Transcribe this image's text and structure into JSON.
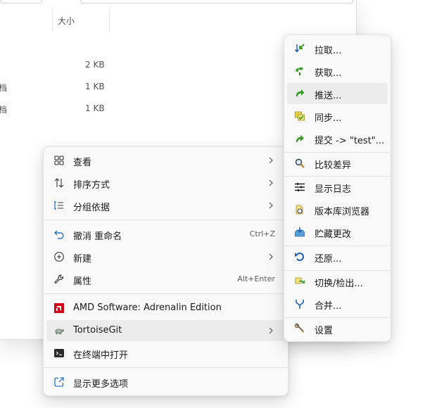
{
  "explorer": {
    "size_header": "大小",
    "files": [
      {
        "type": "",
        "size": "2 KB"
      },
      {
        "type": "档",
        "size": "1 KB"
      },
      {
        "type": "档",
        "size": "1 KB"
      }
    ]
  },
  "main_menu": {
    "items": [
      {
        "label": "查看",
        "icon": "grid-icon",
        "submenu": true
      },
      {
        "label": "排序方式",
        "icon": "sort-arrows-icon",
        "submenu": true
      },
      {
        "label": "分组依据",
        "icon": "list-group-icon",
        "submenu": true
      },
      {
        "label": "撤消 重命名",
        "icon": "undo-icon",
        "shortcut": "Ctrl+Z"
      },
      {
        "label": "新建",
        "icon": "plus-circle-icon",
        "submenu": true
      },
      {
        "label": "属性",
        "icon": "wrench-icon",
        "shortcut": "Alt+Enter"
      },
      {
        "label": "AMD Software: Adrenalin Edition",
        "icon": "amd-logo-icon"
      },
      {
        "label": "TortoiseGit",
        "icon": "tortoise-icon",
        "submenu": true,
        "hovered": true
      },
      {
        "label": "在终端中打开",
        "icon": "terminal-icon"
      },
      {
        "label": "显示更多选项",
        "icon": "share-open-icon"
      }
    ]
  },
  "sub_menu": {
    "items": [
      {
        "label": "拉取...",
        "icon": "pull-icon"
      },
      {
        "label": "获取...",
        "icon": "fetch-icon"
      },
      {
        "label": "推送...",
        "icon": "push-icon",
        "hovered": true
      },
      {
        "label": "同步...",
        "icon": "sync-icon"
      },
      {
        "label": "提交 -> \"test\"...",
        "icon": "commit-icon"
      },
      {
        "label": "比较差异",
        "icon": "diff-magnifier-icon"
      },
      {
        "label": "显示日志",
        "icon": "log-icon"
      },
      {
        "label": "版本库浏览器",
        "icon": "repo-browser-icon"
      },
      {
        "label": "贮藏更改",
        "icon": "stash-icon"
      },
      {
        "label": "还原...",
        "icon": "revert-icon"
      },
      {
        "label": "切换/检出...",
        "icon": "switch-checkout-icon"
      },
      {
        "label": "合并...",
        "icon": "merge-icon"
      },
      {
        "label": "设置",
        "icon": "settings-icon"
      }
    ]
  },
  "colors": {
    "amd_red": "#d0021b",
    "tortoise_green": "#3c9a28",
    "accent_blue": "#0a5fb4"
  }
}
